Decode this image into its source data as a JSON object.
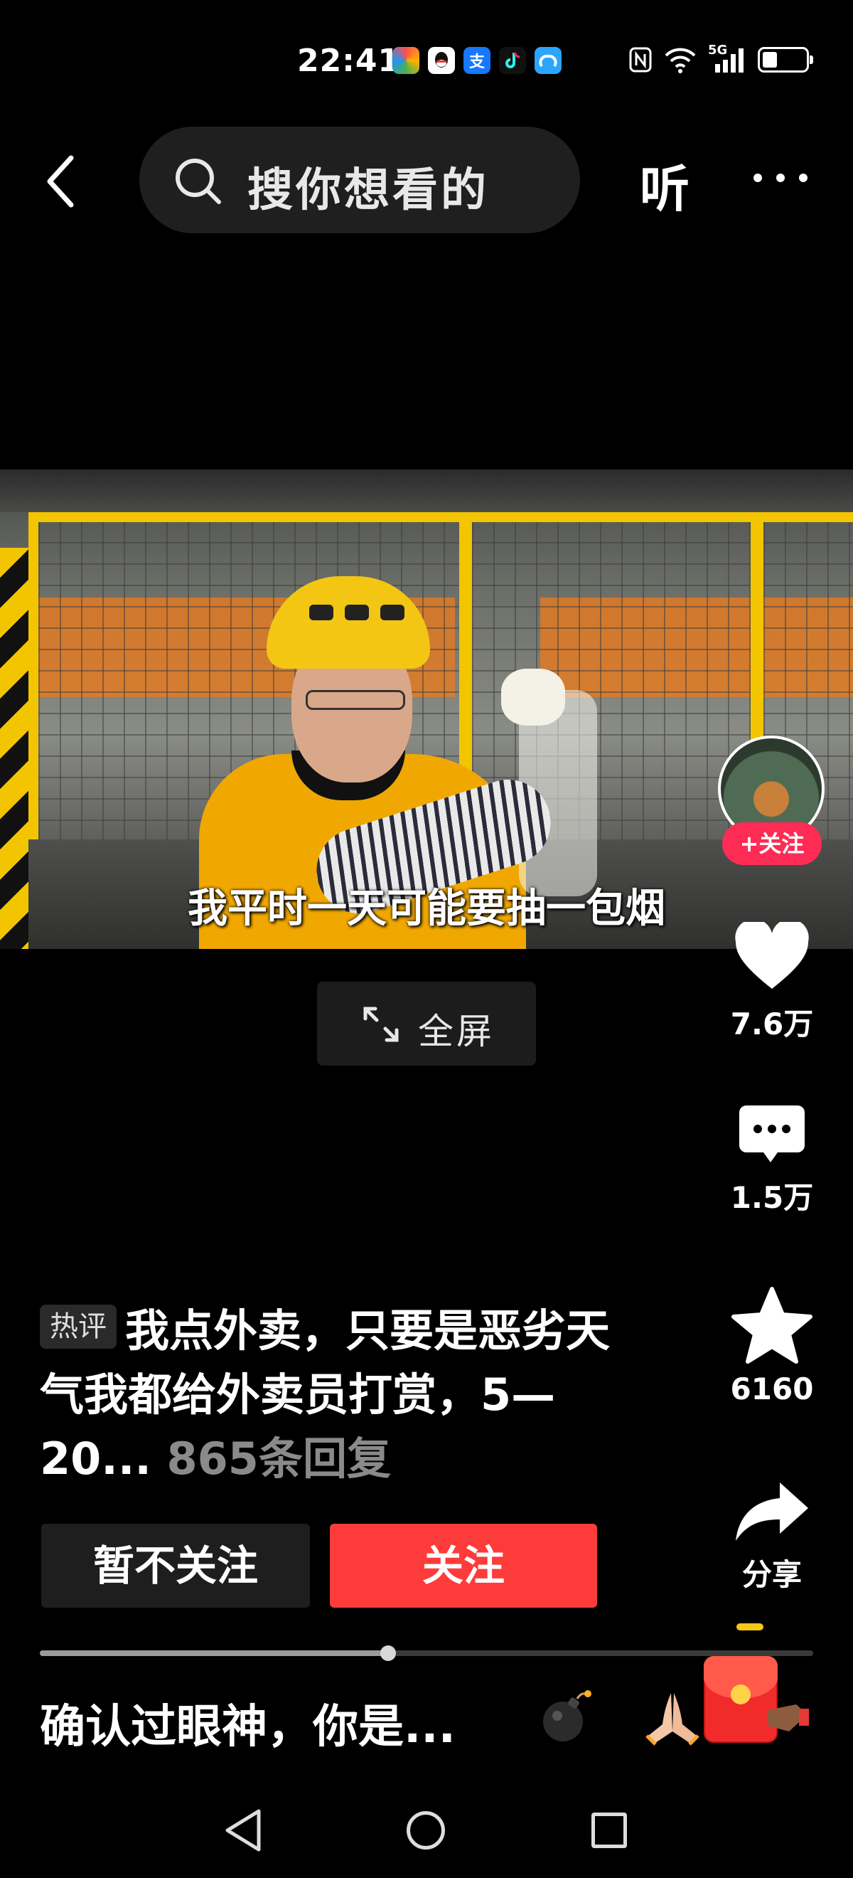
{
  "status_bar": {
    "time": "22:41",
    "app_icons": [
      "photos-icon",
      "qq-icon",
      "alipay-icon",
      "douyin-icon",
      "cloud-icon"
    ],
    "alipay_glyph": "支",
    "system_icons": [
      "nfc-icon",
      "wifi-icon",
      "5g-signal-icon",
      "battery-icon"
    ],
    "signal_label": "5G"
  },
  "top_nav": {
    "search_placeholder": "搜你想看的",
    "listen_label": "听"
  },
  "video": {
    "subtitle": "我平时一天可能要抽一包烟"
  },
  "fullscreen_label": "全屏",
  "author": {
    "follow_chip": "+关注"
  },
  "actions": {
    "likes": "7.6万",
    "comments": "1.5万",
    "favorites": "6160",
    "share": "分享"
  },
  "hot_comment": {
    "tag": "热评",
    "text": "我点外卖，只要是恶劣天气我都给外卖员打赏，5—20...",
    "replies": "865条回复"
  },
  "buttons": {
    "unfollow": "暂不关注",
    "follow": "关注"
  },
  "progress": 0.45,
  "bottom_caption": "确认过眼神，你是...",
  "colors": {
    "follow_red": "#fe3b3b",
    "chip_red": "#fe2c55",
    "background": "#000000"
  }
}
